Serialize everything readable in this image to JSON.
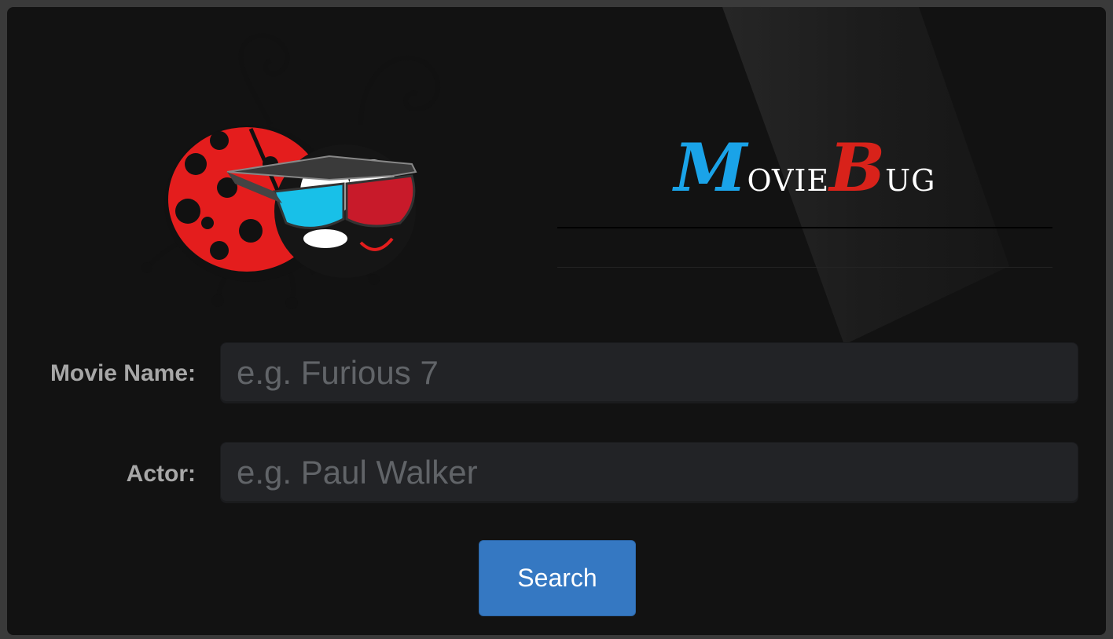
{
  "brand": {
    "cap1": "M",
    "rest1": "ovie",
    "cap2": "B",
    "rest2": "ug",
    "accent_blue": "#1aa3e8",
    "accent_red": "#d8221a"
  },
  "logo": {
    "icon": "ladybug-with-3d-glasses"
  },
  "form": {
    "movie_label": "Movie Name:",
    "movie_placeholder": "e.g. Furious 7",
    "movie_value": "",
    "actor_label": "Actor:",
    "actor_placeholder": "e.g. Paul Walker",
    "actor_value": "",
    "search_label": "Search",
    "button_color": "#3578c2"
  }
}
